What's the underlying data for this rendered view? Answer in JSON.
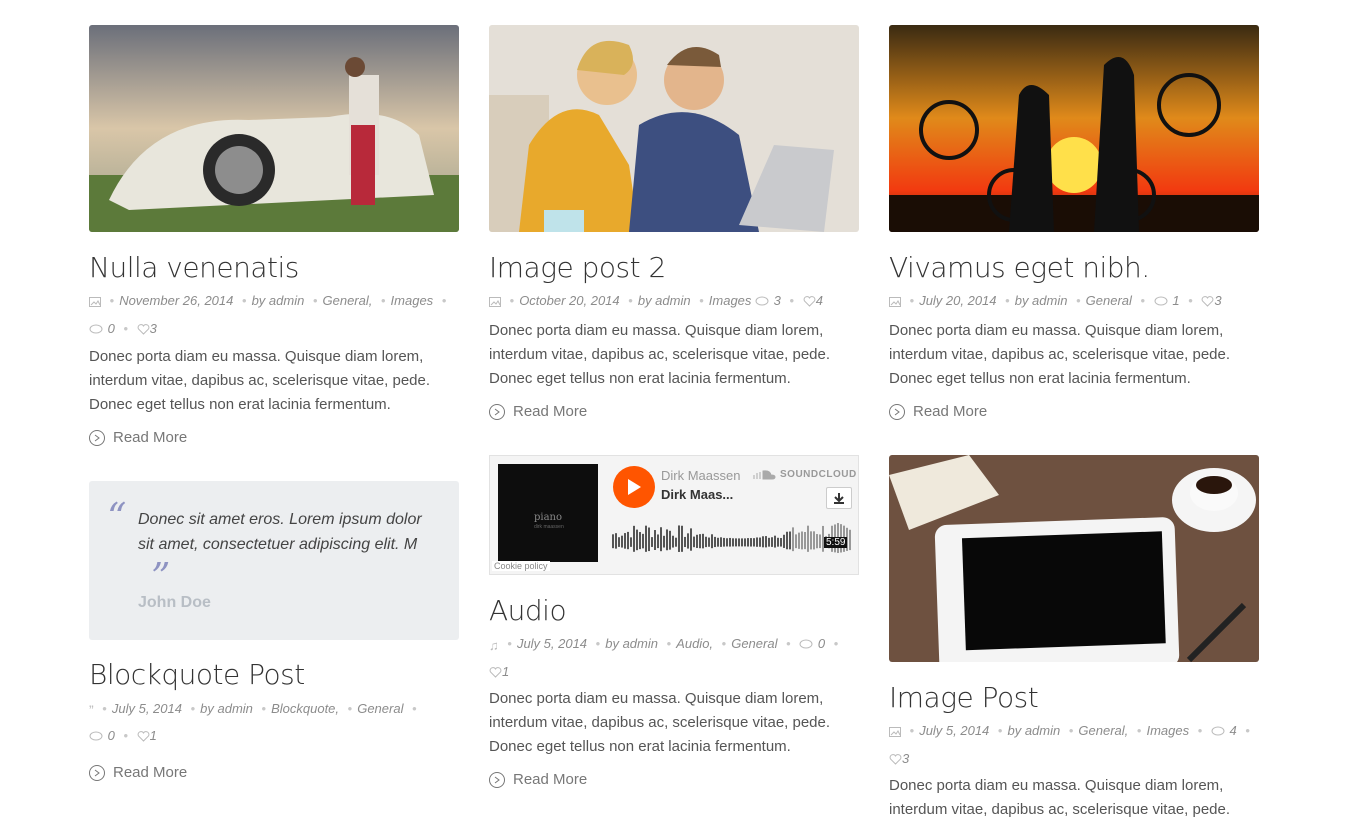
{
  "posts": {
    "p1": {
      "title": "Nulla venenatis",
      "date": "November 26, 2014",
      "author": "by admin",
      "cats": [
        "General",
        "Images"
      ],
      "comments": "0",
      "likes": "3",
      "excerpt": "Donec porta diam eu massa. Quisque diam lorem, interdum vitae, dapibus ac, scelerisque vitae, pede. Donec eget tellus non erat lacinia fermentum.",
      "read_more": "Read More"
    },
    "p2": {
      "title": "Image post 2",
      "date": "October 20, 2014",
      "author": "by admin",
      "cats": [
        "Images"
      ],
      "comments": "3",
      "likes": "4",
      "excerpt": "Donec porta diam eu massa. Quisque diam lorem, interdum vitae, dapibus ac, scelerisque vitae, pede. Donec eget tellus non erat lacinia fermentum.",
      "read_more": "Read More"
    },
    "p3": {
      "title": "Vivamus eget nibh.",
      "date": "July 20, 2014",
      "author": "by admin",
      "cats": [
        "General"
      ],
      "comments": "1",
      "likes": "3",
      "excerpt": "Donec porta diam eu massa. Quisque diam lorem, interdum vitae, dapibus ac, scelerisque vitae, pede. Donec eget tellus non erat lacinia fermentum.",
      "read_more": "Read More"
    },
    "quote": {
      "text": "Donec sit amet eros. Lorem ipsum dolor sit amet, consectetuer adipiscing elit. M",
      "author": "John Doe",
      "title": "Blockquote Post",
      "date": "July 5, 2014",
      "author_meta": "by admin",
      "cats": [
        "Blockquote",
        "General"
      ],
      "comments": "0",
      "likes": "1",
      "read_more": "Read More"
    },
    "audio": {
      "sc_artist": "Dirk Maassen",
      "sc_track": "Dirk Maas...",
      "sc_brand": "SOUNDCLOUD",
      "sc_duration": "5:59",
      "sc_cookie": "Cookie policy",
      "sc_art_title": "piano",
      "sc_art_sub": "dirk maassen",
      "title": "Audio",
      "date": "July 5, 2014",
      "author": "by admin",
      "cats": [
        "Audio",
        "General"
      ],
      "comments": "0",
      "likes": "1",
      "excerpt": "Donec porta diam eu massa. Quisque diam lorem, interdum vitae, dapibus ac, scelerisque vitae, pede. Donec eget tellus non erat lacinia fermentum.",
      "read_more": "Read More"
    },
    "p6": {
      "title": "Image Post",
      "date": "July 5, 2014",
      "author": "by admin",
      "cats": [
        "General",
        "Images"
      ],
      "comments": "4",
      "likes": "3",
      "excerpt": "Donec porta diam eu massa. Quisque diam lorem, interdum vitae, dapibus ac, scelerisque vitae, pede."
    }
  },
  "colors": {
    "soundcloud_orange": "#ff5500",
    "quote_mark": "#8e93c2",
    "meta_text": "#8c8c8c"
  }
}
